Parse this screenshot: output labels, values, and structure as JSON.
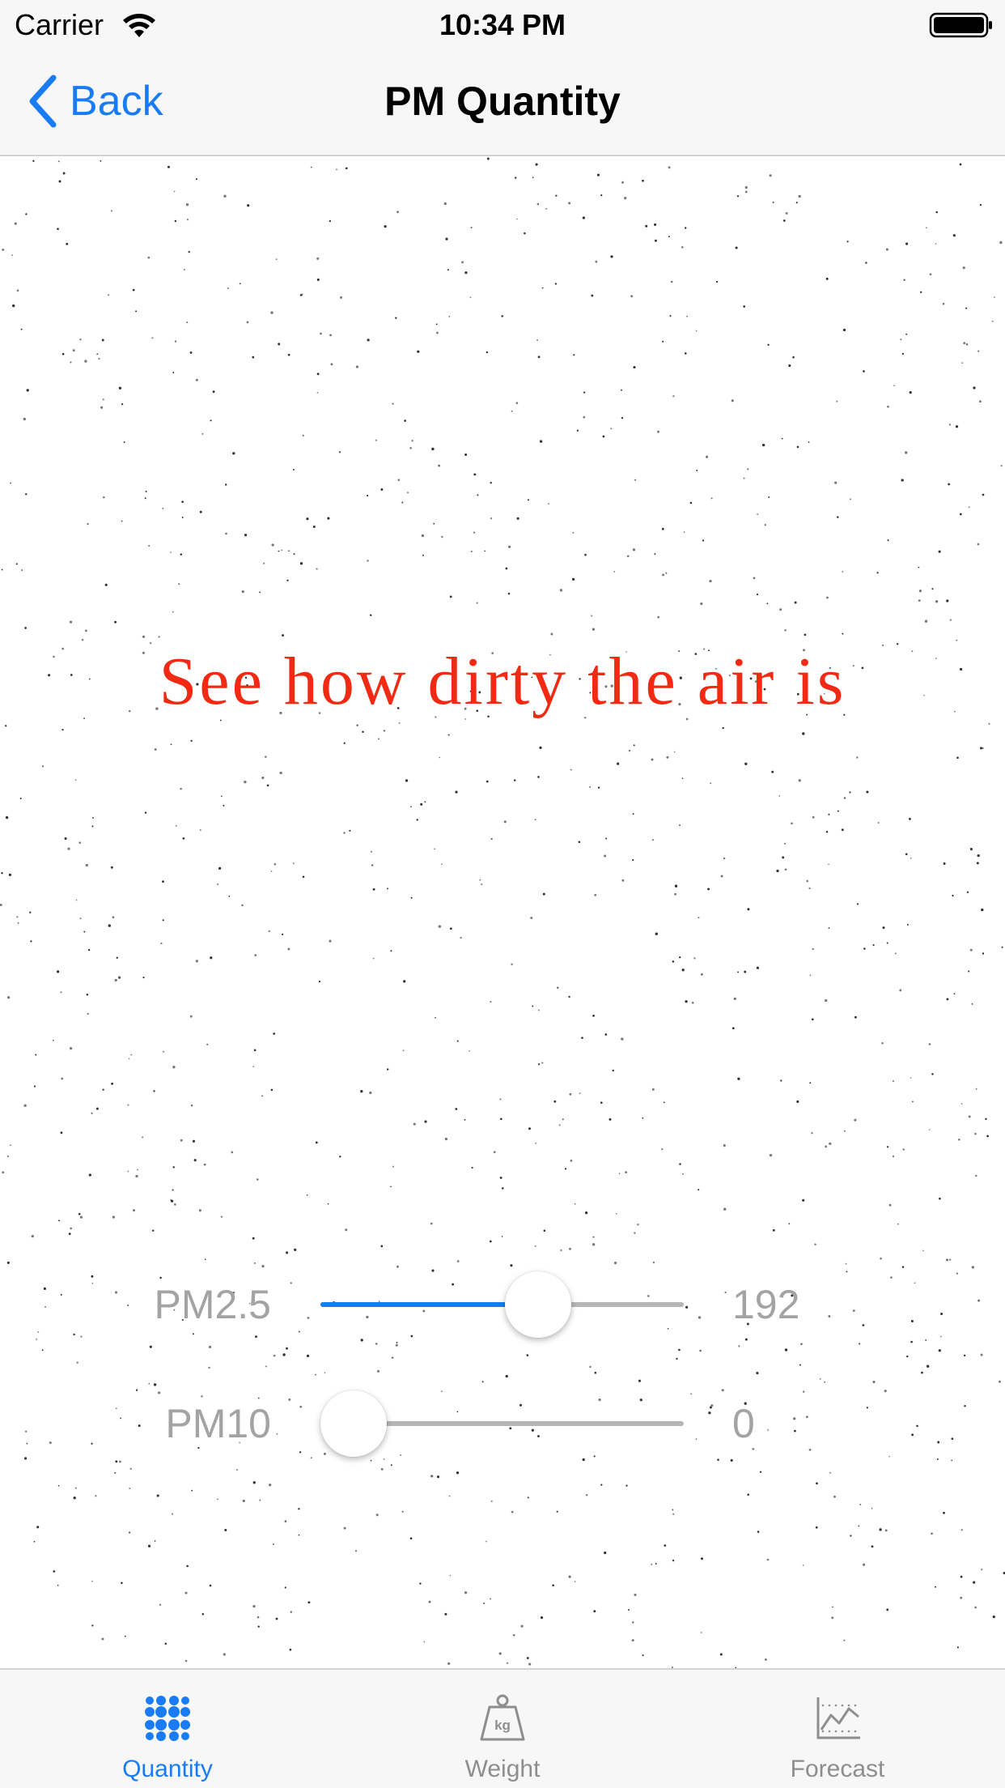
{
  "status_bar": {
    "carrier": "Carrier",
    "time": "10:34 PM"
  },
  "nav": {
    "back_label": "Back",
    "title": "PM Quantity"
  },
  "main": {
    "headline": "See how dirty the air is",
    "headline_color": "#f22a14",
    "sliders": [
      {
        "label": "PM2.5",
        "value": "192",
        "fraction": 0.62
      },
      {
        "label": "PM10",
        "value": "0",
        "fraction": 0.0
      }
    ]
  },
  "tabs": [
    {
      "label": "Quantity",
      "icon": "dots-grid-icon",
      "active": true
    },
    {
      "label": "Weight",
      "icon": "kg-weight-icon",
      "active": false
    },
    {
      "label": "Forecast",
      "icon": "line-chart-icon",
      "active": false
    }
  ],
  "colors": {
    "accent": "#1a7cf5",
    "inactive": "#8e8e8e",
    "slider_text": "#a3a3a3"
  }
}
